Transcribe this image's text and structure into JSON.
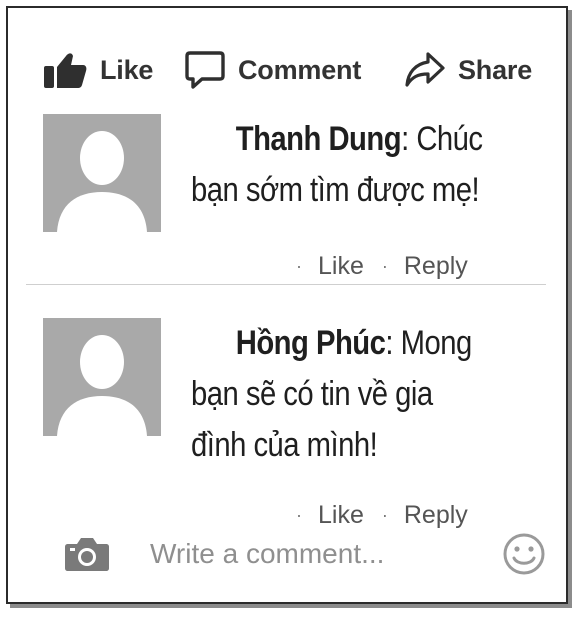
{
  "actions": {
    "like": "Like",
    "comment": "Comment",
    "share": "Share"
  },
  "comments": [
    {
      "author": "Thanh Dung",
      "separator": ":",
      "line1": " Chúc",
      "line2": "bạn sớm tìm được mẹ!",
      "line3": "",
      "like": "Like",
      "reply": "Reply",
      "dot": "·"
    },
    {
      "author": "Hồng Phúc",
      "separator": ":",
      "line1": " Mong",
      "line2": "bạn sẽ có tin về gia",
      "line3": "đình của mình!",
      "like": "Like",
      "reply": "Reply",
      "dot": "·"
    }
  ],
  "composer": {
    "placeholder": "Write a comment..."
  },
  "icons": {
    "like": "thumbs-up-icon",
    "comment": "speech-bubble-icon",
    "share": "share-arrow-icon",
    "camera": "camera-icon",
    "emoji": "smiley-icon"
  },
  "colors": {
    "text": "#333333",
    "muted": "#555555",
    "avatar": "#a9a9a9"
  }
}
